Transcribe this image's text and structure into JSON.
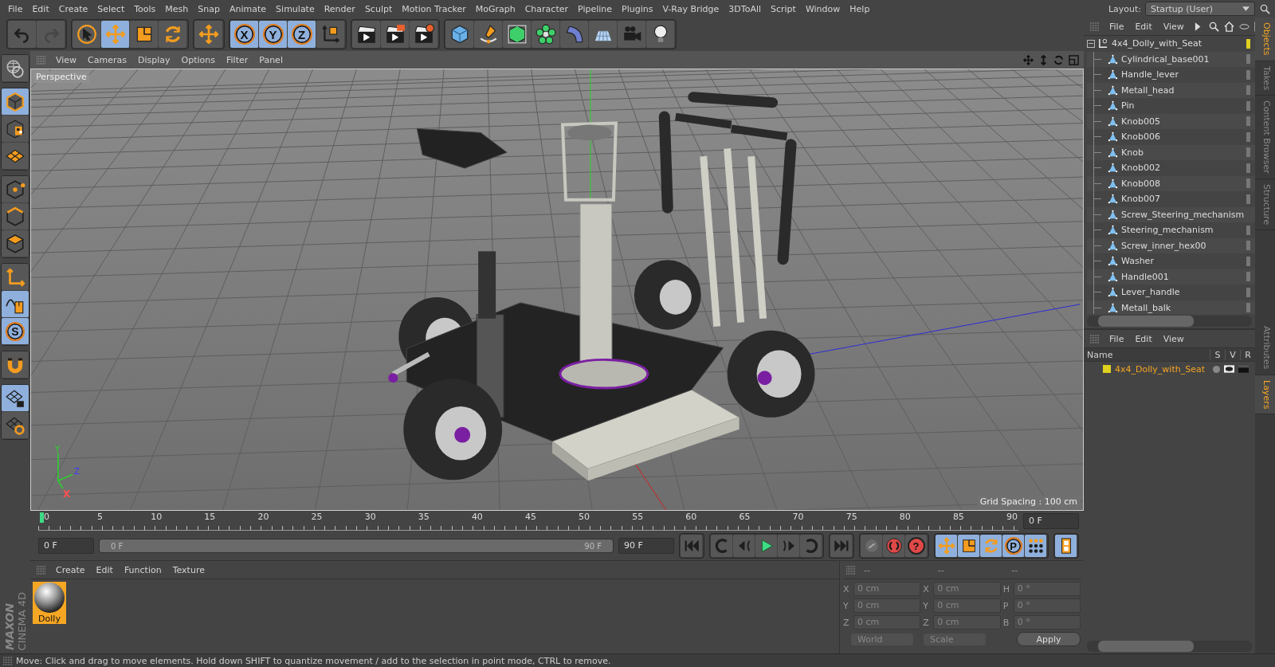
{
  "menu": [
    "File",
    "Edit",
    "Create",
    "Select",
    "Tools",
    "Mesh",
    "Snap",
    "Animate",
    "Simulate",
    "Render",
    "Sculpt",
    "Motion Tracker",
    "MoGraph",
    "Character",
    "Pipeline",
    "Plugins",
    "V-Ray Bridge",
    "3DToAll",
    "Script",
    "Window",
    "Help"
  ],
  "layout": {
    "label": "Layout:",
    "value": "Startup (User)"
  },
  "toolbar": [
    [
      {
        "kind": "undo",
        "selected": false,
        "disabled": false
      },
      {
        "kind": "redo",
        "selected": false,
        "disabled": true
      }
    ],
    [
      {
        "kind": "select",
        "selected": false,
        "disabled": false
      },
      {
        "kind": "move",
        "selected": true,
        "disabled": false
      },
      {
        "kind": "scale",
        "selected": false,
        "disabled": false
      },
      {
        "kind": "rotate",
        "selected": false,
        "disabled": false
      }
    ],
    [
      {
        "kind": "move",
        "selected": false,
        "disabled": false
      }
    ],
    [
      {
        "kind": "letter",
        "label": "X",
        "selected": true,
        "disabled": false
      },
      {
        "kind": "letter",
        "label": "Y",
        "selected": true,
        "disabled": false
      },
      {
        "kind": "letter",
        "label": "Z",
        "selected": true,
        "disabled": false
      },
      {
        "kind": "coord",
        "selected": false,
        "disabled": false
      }
    ],
    [
      {
        "kind": "render_view",
        "selected": false,
        "disabled": false
      },
      {
        "kind": "render_picture",
        "selected": false,
        "disabled": false
      },
      {
        "kind": "render_settings",
        "selected": false,
        "disabled": false
      }
    ],
    [
      {
        "kind": "cube",
        "selected": false,
        "disabled": false
      },
      {
        "kind": "pen",
        "selected": false,
        "disabled": false
      },
      {
        "kind": "green_cube",
        "selected": false,
        "disabled": false
      },
      {
        "kind": "cloner",
        "selected": false,
        "disabled": false
      },
      {
        "kind": "deformer",
        "selected": false,
        "disabled": false
      },
      {
        "kind": "floor",
        "selected": false,
        "disabled": false
      },
      {
        "kind": "camera",
        "selected": false,
        "disabled": false
      },
      {
        "kind": "light",
        "selected": false,
        "disabled": false
      }
    ]
  ],
  "left_toolbar": [
    [
      {
        "kind": "make_editable",
        "selected": false
      }
    ],
    [
      {
        "kind": "model",
        "selected": true
      },
      {
        "kind": "texture",
        "selected": false
      },
      {
        "kind": "uvw",
        "selected": false
      }
    ],
    [
      {
        "kind": "points",
        "selected": false
      },
      {
        "kind": "edges",
        "selected": false
      },
      {
        "kind": "polygons",
        "selected": false
      }
    ],
    [
      {
        "kind": "axis",
        "selected": false
      },
      {
        "kind": "tweak",
        "selected": true
      },
      {
        "kind": "letter",
        "label": "S",
        "selected": true
      }
    ],
    [
      {
        "kind": "magnet",
        "selected": false
      }
    ],
    [
      {
        "kind": "grid_lock",
        "selected": true
      },
      {
        "kind": "grid_rotate",
        "selected": false
      }
    ]
  ],
  "brand": [
    "MAXON",
    "CINEMA 4D"
  ],
  "viewport": {
    "menu": [
      "View",
      "Cameras",
      "Display",
      "Options",
      "Filter",
      "Panel"
    ],
    "camera": "Perspective",
    "grid_spacing": "Grid Spacing : 100 cm",
    "gizmo": [
      "Y",
      "Z",
      "X"
    ]
  },
  "objects": {
    "menu": [
      "File",
      "Edit",
      "View"
    ],
    "root": {
      "name": "4x4_Dolly_with_Seat",
      "expanded": true,
      "children": [
        {
          "name": "Cylindrical_base001"
        },
        {
          "name": "Handle_lever"
        },
        {
          "name": "Metall_head"
        },
        {
          "name": "Pin"
        },
        {
          "name": "Knob005"
        },
        {
          "name": "Knob006"
        },
        {
          "name": "Knob"
        },
        {
          "name": "Knob002"
        },
        {
          "name": "Knob008"
        },
        {
          "name": "Knob007"
        },
        {
          "name": "Screw_Steering_mechanism"
        },
        {
          "name": "Steering_mechanism"
        },
        {
          "name": "Screw_inner_hex00"
        },
        {
          "name": "Washer"
        },
        {
          "name": "Handle001"
        },
        {
          "name": "Lever_handle"
        },
        {
          "name": "Metall_balk"
        }
      ]
    }
  },
  "side_tabs_top": [
    {
      "label": "Objects",
      "selected": true
    },
    {
      "label": "Takes",
      "selected": false
    },
    {
      "label": "Content Browser",
      "selected": false
    },
    {
      "label": "Structure",
      "selected": false
    }
  ],
  "side_tabs_bottom": [
    {
      "label": "Attributes",
      "selected": false
    },
    {
      "label": "Layers",
      "selected": true
    }
  ],
  "layers": {
    "menu": [
      "File",
      "Edit",
      "View"
    ],
    "columns": [
      "Name",
      "S",
      "V",
      "R"
    ],
    "rows": [
      {
        "name": "4x4_Dolly_with_Seat",
        "color": "#e0d020"
      }
    ]
  },
  "timeline": {
    "range": {
      "level": 1
    },
    "ticks": [
      "0",
      "5",
      "10",
      "15",
      "20",
      "25",
      "30",
      "35",
      "40",
      "45",
      "50",
      "55",
      "60",
      "65",
      "70",
      "75",
      "80",
      "85",
      "90"
    ],
    "playhead": {
      "level": 0
    },
    "current": "0 F",
    "start": "0 F",
    "range_start": "0 F",
    "range_end": "90 F",
    "end": "90 F"
  },
  "playback": [
    [
      {
        "kind": "first"
      }
    ],
    [
      {
        "kind": "prev_key"
      },
      {
        "kind": "step_back"
      },
      {
        "kind": "play"
      },
      {
        "kind": "step_forward"
      },
      {
        "kind": "next_key"
      }
    ],
    [
      {
        "kind": "last"
      }
    ],
    [
      {
        "kind": "record"
      },
      {
        "kind": "autokey"
      },
      {
        "kind": "help",
        "label": "?"
      }
    ],
    [
      {
        "kind": "move"
      },
      {
        "kind": "scale"
      },
      {
        "kind": "rotate"
      },
      {
        "kind": "letter",
        "label": "P"
      },
      {
        "kind": "dots"
      }
    ],
    [
      {
        "kind": "film"
      }
    ]
  ],
  "materials": {
    "menu": [
      "Create",
      "Edit",
      "Function",
      "Texture"
    ],
    "items": [
      {
        "name": "Dolly",
        "selected": true
      }
    ]
  },
  "coordinates": {
    "headers": [
      "--",
      "--",
      "--"
    ],
    "rows": [
      [
        {
          "axis": "X",
          "value": "0 cm"
        },
        {
          "axis": "X",
          "value": "0 cm"
        },
        {
          "axis": "H",
          "value": "0 °"
        }
      ],
      [
        {
          "axis": "Y",
          "value": "0 cm"
        },
        {
          "axis": "Y",
          "value": "0 cm"
        },
        {
          "axis": "P",
          "value": "0 °"
        }
      ],
      [
        {
          "axis": "Z",
          "value": "0 cm"
        },
        {
          "axis": "Z",
          "value": "0 cm"
        },
        {
          "axis": "B",
          "value": "0 °"
        }
      ]
    ],
    "dropdowns": [
      "World",
      "Scale"
    ],
    "apply": "Apply"
  },
  "status_bar": "Move: Click and drag to move elements. Hold down SHIFT to quantize movement / add to the selection in point mode, CTRL to remove."
}
